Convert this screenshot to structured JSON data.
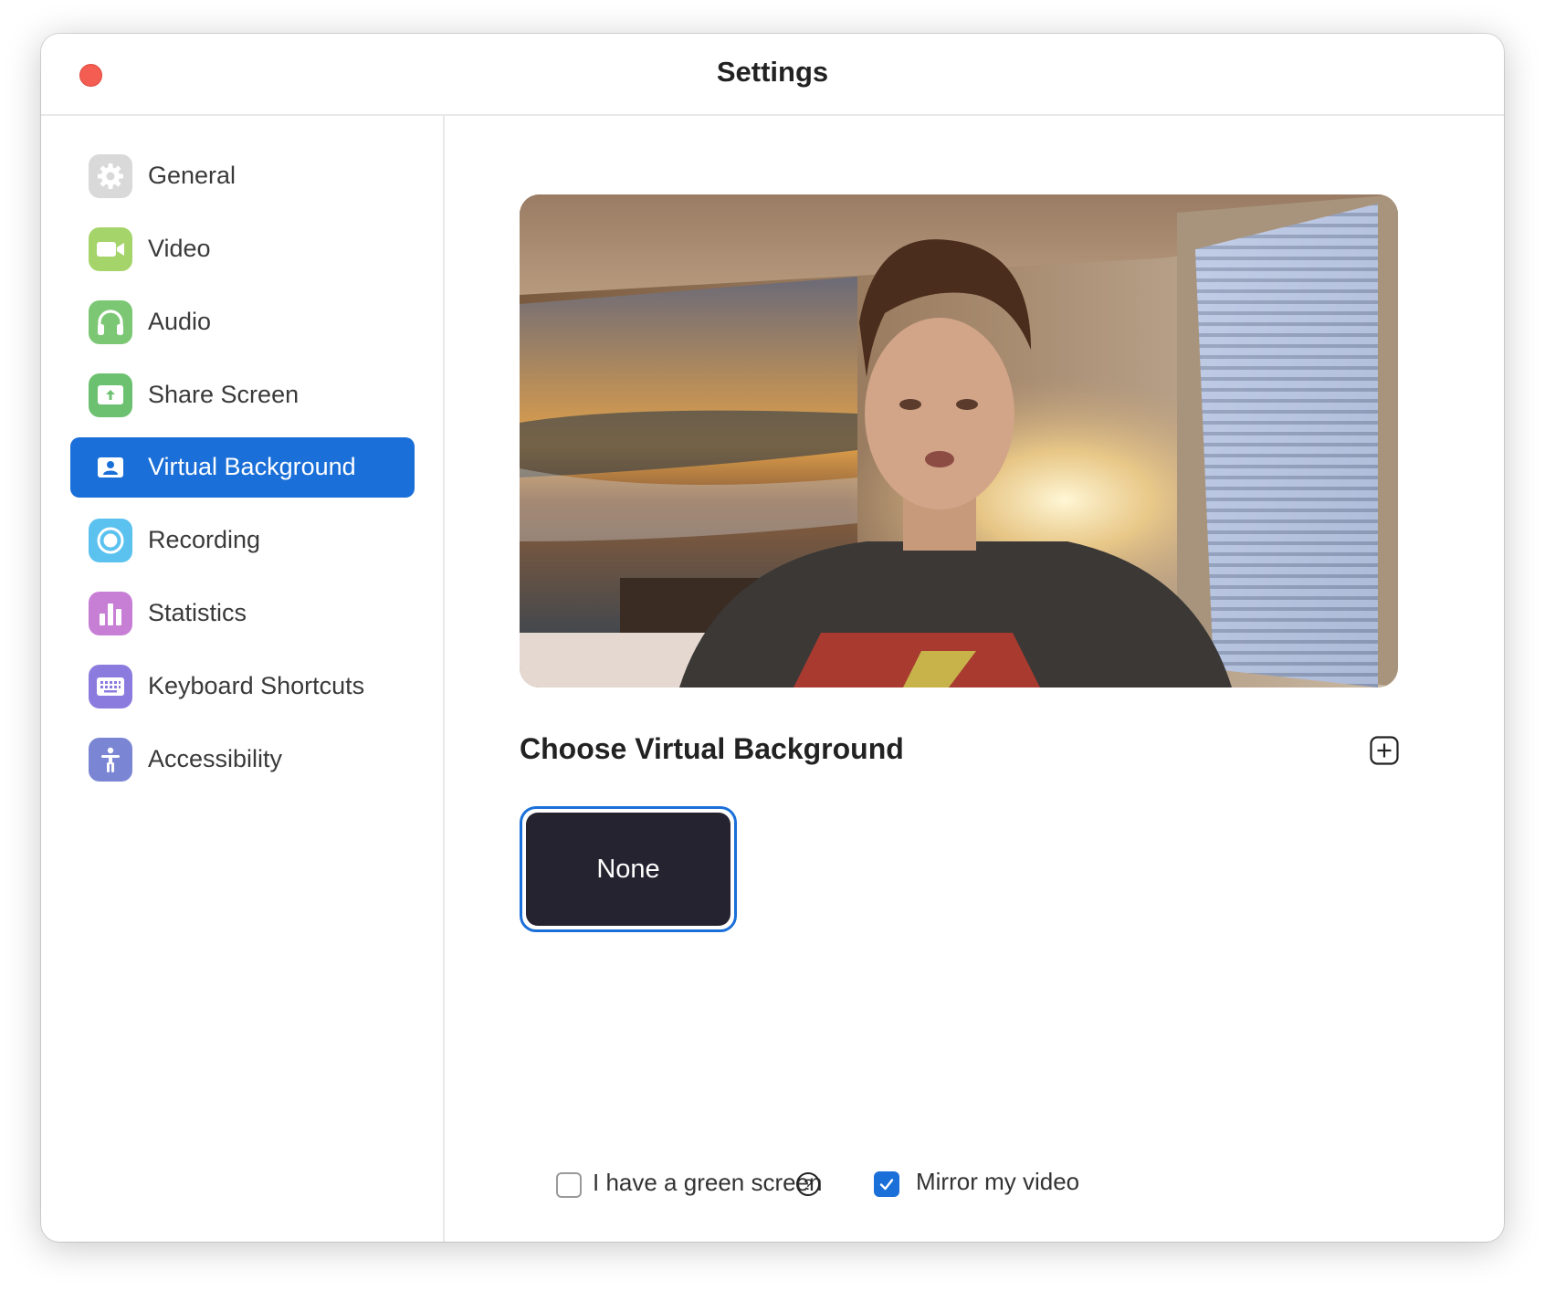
{
  "window": {
    "title": "Settings"
  },
  "sidebar": {
    "items": [
      {
        "label": "General",
        "icon": "gear-icon",
        "color": "#d9d9d9",
        "active": false
      },
      {
        "label": "Video",
        "icon": "video-camera-icon",
        "color": "#a5d46b",
        "active": false
      },
      {
        "label": "Audio",
        "icon": "headphones-icon",
        "color": "#7bc774",
        "active": false
      },
      {
        "label": "Share Screen",
        "icon": "share-screen-icon",
        "color": "#6cc170",
        "active": false
      },
      {
        "label": "Virtual Background",
        "icon": "person-portrait-icon",
        "color": "#1a6fd8",
        "active": true
      },
      {
        "label": "Recording",
        "icon": "record-icon",
        "color": "#5bc2ef",
        "active": false
      },
      {
        "label": "Statistics",
        "icon": "bar-chart-icon",
        "color": "#c77fd6",
        "active": false
      },
      {
        "label": "Keyboard Shortcuts",
        "icon": "keyboard-icon",
        "color": "#8c7bde",
        "active": false
      },
      {
        "label": "Accessibility",
        "icon": "accessibility-icon",
        "color": "#7a86d4",
        "active": false
      }
    ]
  },
  "main": {
    "section_title": "Choose Virtual Background",
    "backgrounds": [
      {
        "label": "None",
        "selected": true
      }
    ],
    "options": {
      "green_screen": {
        "label": "I have a green screen",
        "checked": false
      },
      "mirror": {
        "label": "Mirror my video",
        "checked": true
      }
    }
  },
  "colors": {
    "accent": "#1a6fd8",
    "close": "#f45d52",
    "tile": "#24232f"
  }
}
